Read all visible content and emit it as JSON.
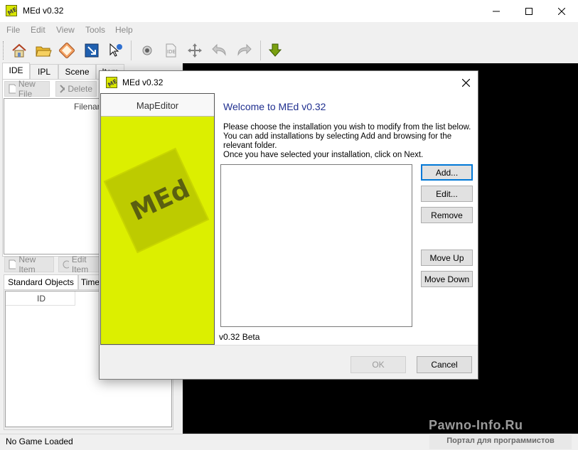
{
  "window": {
    "title": "MEd v0.32"
  },
  "menu": [
    "File",
    "Edit",
    "View",
    "Tools",
    "Help"
  ],
  "left_panel": {
    "tabs": [
      "IDE",
      "IPL",
      "Scene",
      "Item"
    ],
    "ide_buttons": {
      "new_file": "New File",
      "delete": "Delete"
    },
    "ide_list_header": "Filename",
    "item_buttons": {
      "new_item": "New Item",
      "edit_item": "Edit Item"
    },
    "bottom_tabs": [
      "Standard Objects",
      "Time"
    ],
    "bottom_list_header": "ID"
  },
  "status": {
    "text": "No Game Loaded"
  },
  "watermark": {
    "title": "Pawno-Info.Ru",
    "subtitle": "Портал для программистов"
  },
  "dialog": {
    "title": "MEd v0.32",
    "banner_header": "MapEditor",
    "banner_logo": "MEd",
    "welcome": "Welcome to MEd v0.32",
    "desc_1": "Please choose the installation you wish to modify from the list below. You can add installations by selecting Add and browsing for the relevant folder.",
    "desc_2": "Once you have selected your installation, click on Next.",
    "buttons": {
      "add": "Add...",
      "edit": "Edit...",
      "remove": "Remove",
      "move_up": "Move Up",
      "move_down": "Move Down"
    },
    "version": "v0.32 Beta",
    "ok": "OK",
    "cancel": "Cancel"
  },
  "colors": {
    "banner": "#dcef00",
    "welcome": "#1f2f8f",
    "viewport": "#000000"
  }
}
